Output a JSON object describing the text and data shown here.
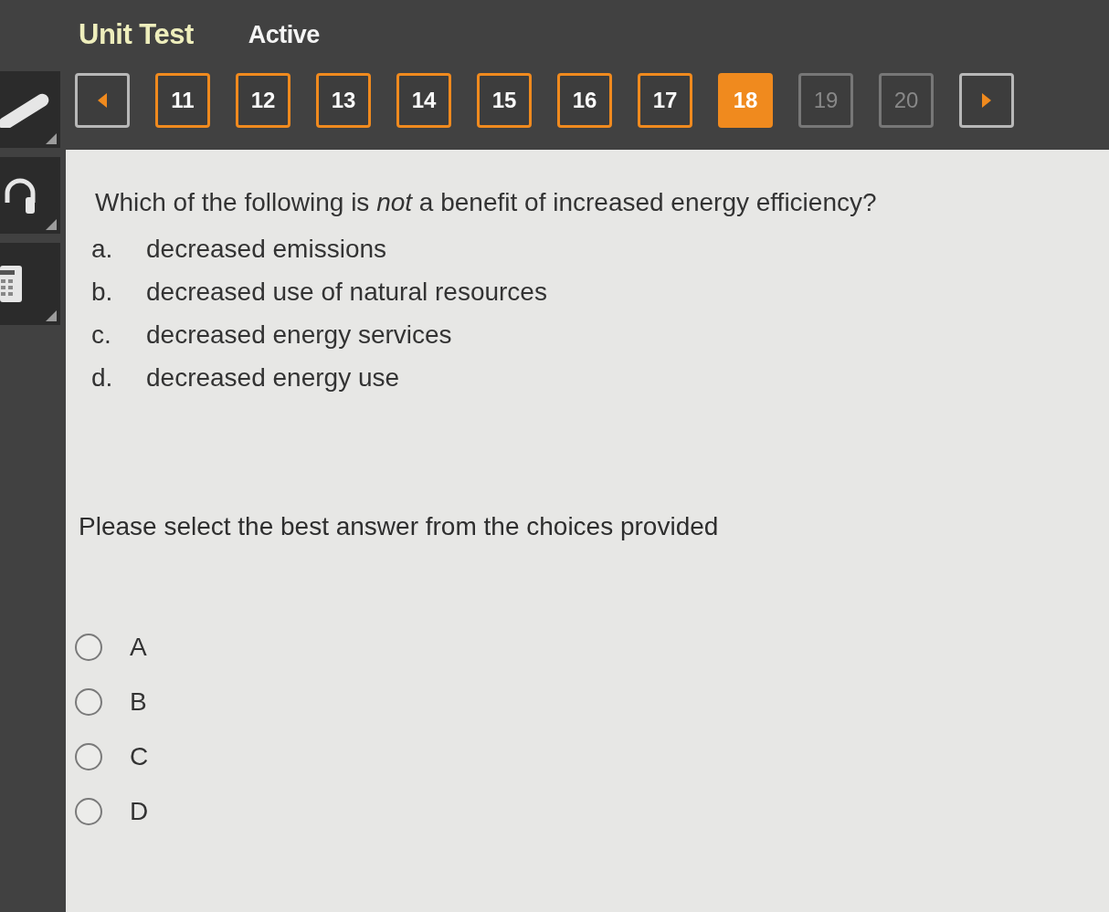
{
  "header": {
    "title": "Unit Test",
    "status": "Active"
  },
  "question_nav": [
    {
      "label": "11",
      "selected": false,
      "visited": true
    },
    {
      "label": "12",
      "selected": false,
      "visited": true
    },
    {
      "label": "13",
      "selected": false,
      "visited": true
    },
    {
      "label": "14",
      "selected": false,
      "visited": true
    },
    {
      "label": "15",
      "selected": false,
      "visited": true
    },
    {
      "label": "16",
      "selected": false,
      "visited": true
    },
    {
      "label": "17",
      "selected": false,
      "visited": true
    },
    {
      "label": "18",
      "selected": true,
      "visited": true
    },
    {
      "label": "19",
      "selected": false,
      "visited": false
    },
    {
      "label": "20",
      "selected": false,
      "visited": false
    }
  ],
  "question": {
    "prompt": "Which of the following is *not* a benefit of increased energy efficiency?",
    "choices": [
      {
        "letter": "a.",
        "text": "decreased emissions"
      },
      {
        "letter": "b.",
        "text": "decreased use of natural resources"
      },
      {
        "letter": "c.",
        "text": "decreased energy services"
      },
      {
        "letter": "d.",
        "text": "decreased energy use"
      }
    ]
  },
  "instruction": "Please select the best answer from the choices provided",
  "answers": [
    {
      "label": "A",
      "selected": false
    },
    {
      "label": "B",
      "selected": false
    },
    {
      "label": "C",
      "selected": false
    },
    {
      "label": "D",
      "selected": false
    }
  ]
}
